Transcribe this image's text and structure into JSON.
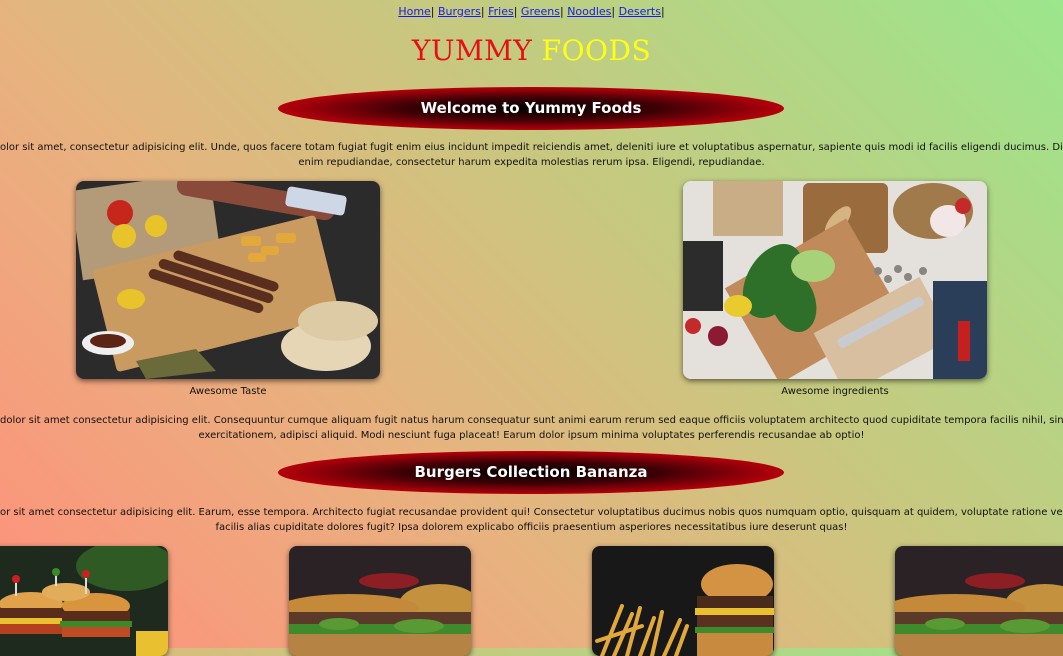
{
  "nav": {
    "items": [
      "Home",
      "Burgers",
      "Fries",
      "Greens",
      "Noodles",
      "Deserts"
    ],
    "separator": "|"
  },
  "site_title": {
    "word1": "YUMMY",
    "word2": "FOODS",
    "colors": {
      "word1": "#e60f14",
      "word2": "#ffff16"
    }
  },
  "section1": {
    "heading": "Welcome to Yummy Foods",
    "para_line1": "olor sit amet, consectetur adipisicing elit. Unde, quos facere totam fugiat fugit enim eius incidunt impedit reiciendis amet, deleniti iure et voluptatibus aspernatur, sapiente quis modi id facilis eligendi ducimus. Dicta similique ex, accusam",
    "para_line2": "enim repudiandae, consectetur harum expedita molestias rerum ipsa. Eligendi, repudiandae."
  },
  "gallery": [
    {
      "caption": "Awesome Taste",
      "image": "grilled-kebab-platter"
    },
    {
      "caption": "Awesome ingredients",
      "image": "fresh-vegetables-board"
    }
  ],
  "section2": {
    "para_line1": "dolor sit amet consectetur adipisicing elit. Consequuntur cumque aliquam fugit natus harum consequatur sunt animi earum rerum sed eaque officiis voluptatem architecto quod cupiditate tempora facilis nihil, sint, reiciendis pariatur atqu",
    "para_line2": "exercitationem, adipisci aliquid. Modi nesciunt fuga placeat! Earum dolor ipsum minima voluptates perferendis recusandae ab optio!"
  },
  "section3": {
    "heading": "Burgers Collection Bananza",
    "para_line1": "or sit amet consectetur adipisicing elit. Earum, esse tempora. Architecto fugiat recusandae provident qui! Consectetur voluptatibus ducimus nobis quos numquam optio, quisquam at quidem, voluptate ratione veniam, perspiciatis obcaecati",
    "para_line2": "facilis alias cupiditate dolores fugit? Ipsa dolorem explicabo officiis praesentium asperiores necessitatibus iure deserunt quas!"
  },
  "burgers": [
    "burger-platter-photo",
    "burger-closeup-photo",
    "burger-with-fries-photo",
    "burger-closeup-photo-2"
  ]
}
